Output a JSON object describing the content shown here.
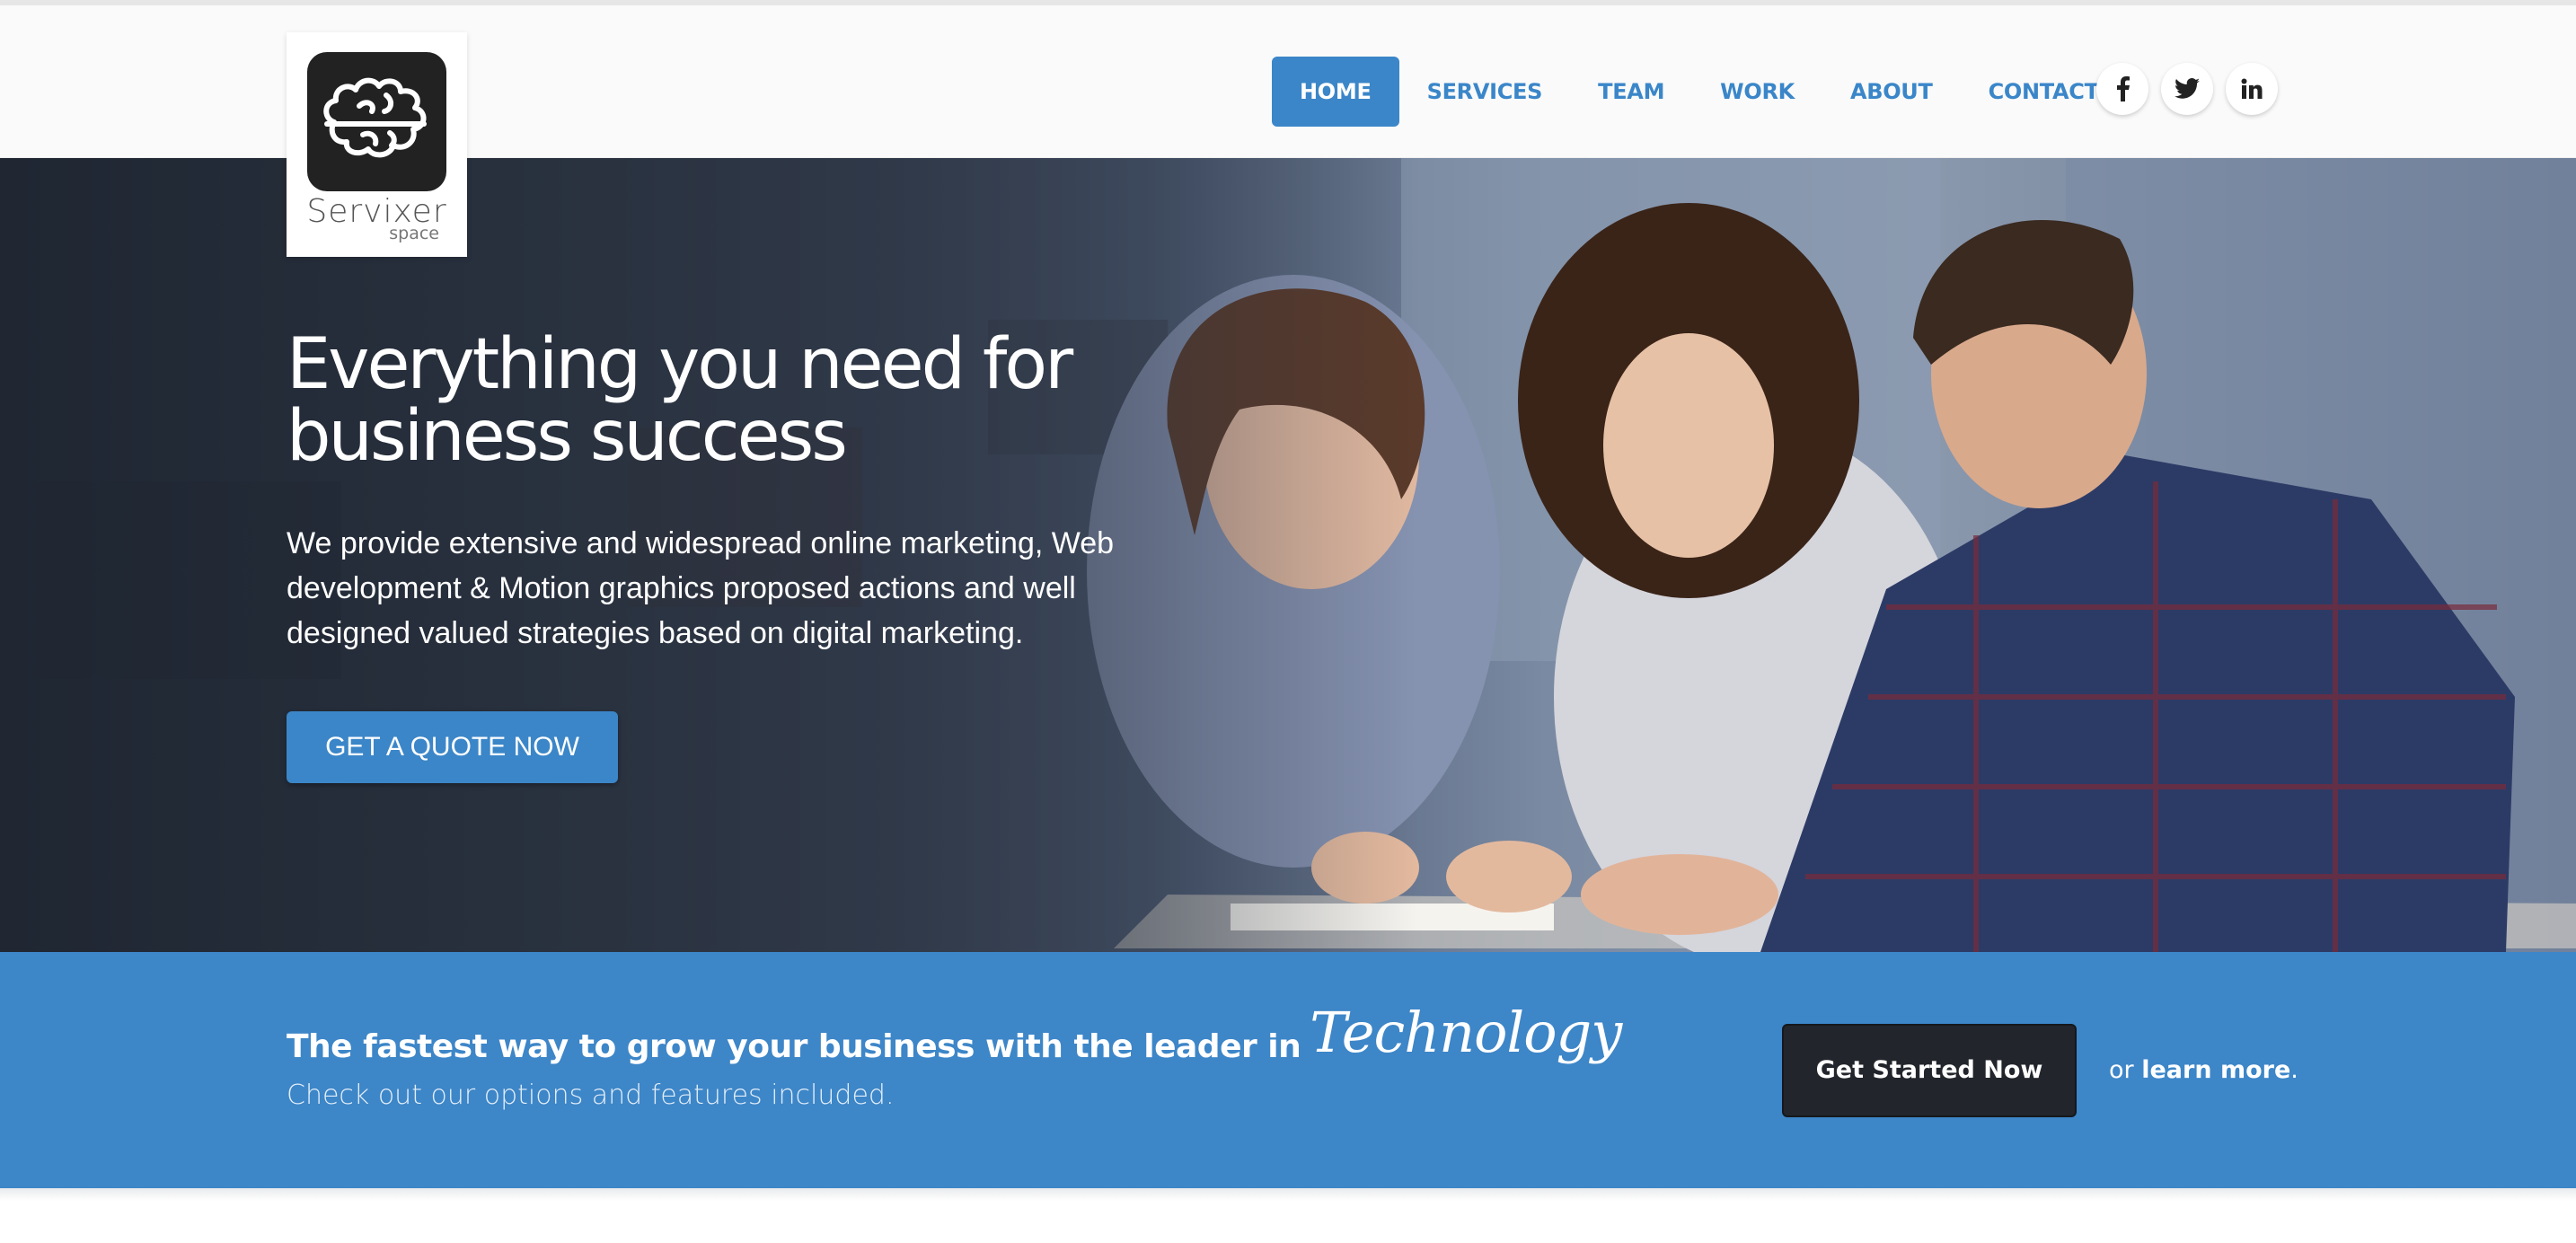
{
  "brand": {
    "name": "Servixer",
    "sub": "space"
  },
  "nav": {
    "items": [
      "HOME",
      "SERVICES",
      "TEAM",
      "WORK",
      "ABOUT",
      "CONTACT"
    ],
    "active": "HOME"
  },
  "social": [
    "facebook-icon",
    "twitter-icon",
    "linkedin-icon"
  ],
  "hero": {
    "title": "Everything you need for business success",
    "description": "We provide extensive and widespread online marketing, Web development & Motion graphics proposed actions and well designed valued strategies based on digital marketing.",
    "button": "GET A QUOTE NOW"
  },
  "cta": {
    "headline": "The fastest way to grow your business with the leader in",
    "accent": "Technology",
    "sub": "Check out our options and features included.",
    "button": "Get Started Now",
    "or": "or",
    "learn": "learn more",
    "period": "."
  },
  "colors": {
    "primary": "#3b86c8",
    "band": "#3d86c8",
    "dark_button": "#22262c",
    "nav_text": "#3a86c9"
  }
}
